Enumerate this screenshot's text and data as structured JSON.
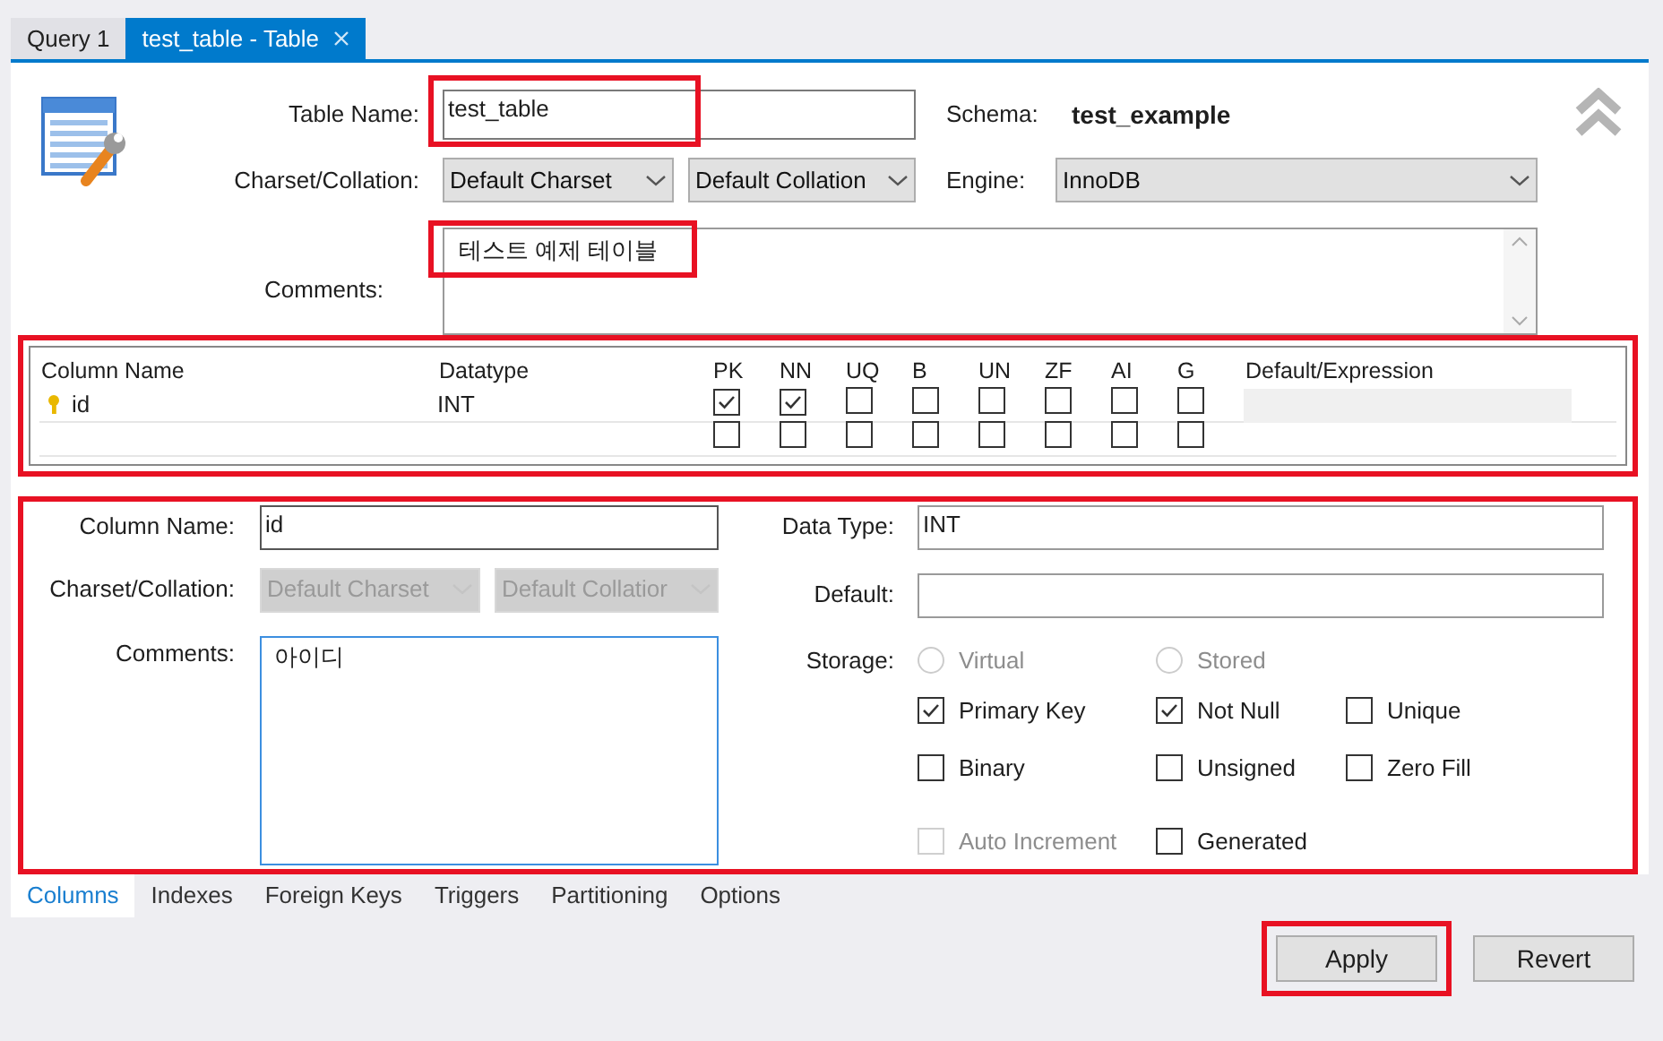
{
  "tabs": [
    {
      "label": "Query 1",
      "selected": false,
      "closable": false
    },
    {
      "label": "test_table - Table",
      "selected": true,
      "closable": true
    }
  ],
  "table": {
    "table_name_label": "Table Name:",
    "table_name": "test_table",
    "table_name_highlighted": true,
    "schema_label": "Schema:",
    "schema": "test_example",
    "charset_label": "Charset/Collation:",
    "charset": "Default Charset",
    "collation": "Default Collation",
    "engine_label": "Engine:",
    "engine": "InnoDB",
    "comments_label": "Comments:",
    "comments": "테스트 예제 테이블",
    "comments_highlighted": true
  },
  "grid": {
    "highlighted": true,
    "columns": [
      "Column Name",
      "Datatype",
      "PK",
      "NN",
      "UQ",
      "B",
      "UN",
      "ZF",
      "AI",
      "G",
      "Default/Expression"
    ],
    "rows": [
      {
        "kind": "column",
        "name": "id",
        "datatype": "INT",
        "primary_key": true,
        "flags": [
          {
            "checked": true
          },
          {
            "checked": true
          },
          {
            "checked": false
          },
          {
            "checked": false
          },
          {
            "checked": false
          },
          {
            "checked": false
          },
          {
            "checked": false
          },
          {
            "checked": false
          }
        ]
      },
      {
        "kind": "new",
        "flags": [
          {
            "checked": false
          },
          {
            "checked": false
          },
          {
            "checked": false
          },
          {
            "checked": false
          },
          {
            "checked": false
          },
          {
            "checked": false
          },
          {
            "checked": false
          },
          {
            "checked": false
          }
        ]
      }
    ]
  },
  "details": {
    "highlighted": true,
    "column_name_label": "Column Name:",
    "column_name": "id",
    "charset_label": "Charset/Collation:",
    "charset": "Default Charset",
    "collation": "Default Collatior",
    "charset_disabled": true,
    "comments_label": "Comments:",
    "comments": "아이디",
    "data_type_label": "Data Type:",
    "data_type": "INT",
    "default_label": "Default:",
    "storage_label": "Storage:",
    "storage_options": [
      {
        "label": "Virtual",
        "selected": false,
        "disabled": true
      },
      {
        "label": "Stored",
        "selected": false,
        "disabled": true
      }
    ],
    "options": [
      {
        "label": "Primary Key",
        "checked": true,
        "disabled": false
      },
      {
        "label": "Not Null",
        "checked": true,
        "disabled": false
      },
      {
        "label": "Unique",
        "checked": false,
        "disabled": false
      },
      {
        "label": "Binary",
        "checked": false,
        "disabled": false
      },
      {
        "label": "Unsigned",
        "checked": false,
        "disabled": false
      },
      {
        "label": "Zero Fill",
        "checked": false,
        "disabled": false
      },
      {
        "label": "Auto Increment",
        "checked": false,
        "disabled": true
      },
      {
        "label": "Generated",
        "checked": false,
        "disabled": false
      }
    ]
  },
  "bottom_tabs": [
    {
      "label": "Columns",
      "selected": true
    },
    {
      "label": "Indexes",
      "selected": false
    },
    {
      "label": "Foreign Keys",
      "selected": false
    },
    {
      "label": "Triggers",
      "selected": false
    },
    {
      "label": "Partitioning",
      "selected": false
    },
    {
      "label": "Options",
      "selected": false
    }
  ],
  "buttons": [
    {
      "label": "Apply",
      "highlighted": true
    },
    {
      "label": "Revert",
      "highlighted": false
    }
  ]
}
